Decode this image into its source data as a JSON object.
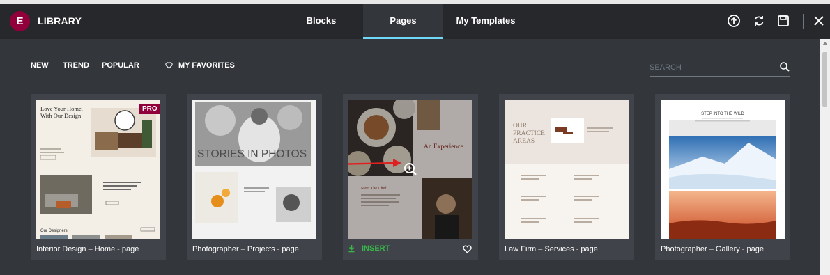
{
  "header": {
    "logo_glyph": "E",
    "title": "LIBRARY",
    "tabs": [
      {
        "label": "Blocks",
        "active": false
      },
      {
        "label": "Pages",
        "active": true
      },
      {
        "label": "My Templates",
        "active": false
      }
    ],
    "icons": [
      "upload-icon",
      "sync-icon",
      "save-icon",
      "close-icon"
    ],
    "accent_color": "#71d7f7",
    "brand_color": "#92003b"
  },
  "filters": {
    "items": [
      "NEW",
      "TREND",
      "POPULAR"
    ],
    "favorites_label": "MY FAVORITES"
  },
  "search": {
    "placeholder": "SEARCH"
  },
  "cards": [
    {
      "title": "Interior Design – Home - page",
      "badge": "PRO",
      "thumb": {
        "heading_line1": "Love Your Home,",
        "heading_line2": "With Our Design",
        "footer_text": "Our Designers"
      }
    },
    {
      "title": "Photographer – Projects - page",
      "thumb": {
        "heading": "STORIES IN PHOTOS"
      }
    },
    {
      "title": "",
      "insert_label": "INSERT",
      "thumb": {
        "heading": "An Experience",
        "subheading": "Meet The Chef"
      }
    },
    {
      "title": "Law Firm – Services - page",
      "thumb": {
        "heading_line1": "OUR",
        "heading_line2": "PRACTICE",
        "heading_line3": "AREAS"
      }
    },
    {
      "title": "Photographer – Gallery - page",
      "thumb": {
        "heading": "STEP INTO THE WILD"
      }
    }
  ]
}
